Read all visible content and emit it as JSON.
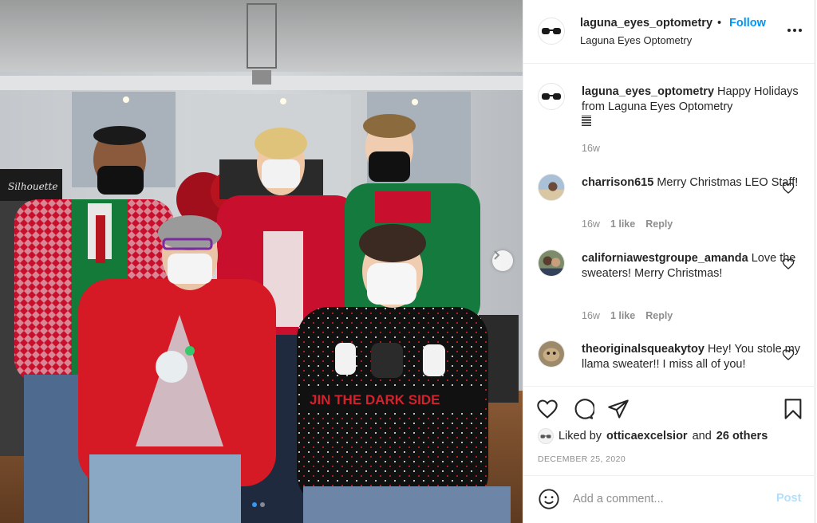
{
  "post": {
    "username": "laguna_eyes_optometry",
    "separator": "•",
    "follow_label": "Follow",
    "full_name": "Laguna Eyes Optometry",
    "caption_user": "laguna_eyes_optometry",
    "caption_text": "Happy Holidays from Laguna Eyes Optometry",
    "caption_time": "16w",
    "carousel_pages": 2,
    "carousel_current": 1
  },
  "photo": {
    "sign_text": "Silhouette",
    "sweater_text": "JIN THE DARK SIDE"
  },
  "comments": [
    {
      "user": "charrison615",
      "text": "Merry Christmas LEO Staff!",
      "time": "16w",
      "likes": "1 like",
      "reply": "Reply"
    },
    {
      "user": "californiawestgroupe_amanda",
      "text": "Love the sweaters! Merry Christmas!",
      "time": "16w",
      "likes": "1 like",
      "reply": "Reply"
    },
    {
      "user": "theoriginalsqueakytoy",
      "text": "Hey! You stole my llama sweater!! I miss all of you!"
    }
  ],
  "engagement": {
    "liked_prefix": "Liked by",
    "liked_user": "otticaexcelsior",
    "liked_and": "and",
    "liked_others": "26 others",
    "date": "DECEMBER 25, 2020"
  },
  "comment_box": {
    "placeholder": "Add a comment...",
    "post_label": "Post"
  },
  "icons": {
    "avatar": "glasses-icon",
    "heart": "heart-icon",
    "comment": "comment-icon",
    "share": "share-icon",
    "save": "bookmark-icon",
    "emoji": "smiley-icon",
    "more": "ellipsis-icon",
    "next": "chevron-right-icon"
  },
  "colors": {
    "follow": "#0095f6",
    "post_disabled": "#b2dffc",
    "muted": "#8e8e8e",
    "text": "#262626"
  }
}
